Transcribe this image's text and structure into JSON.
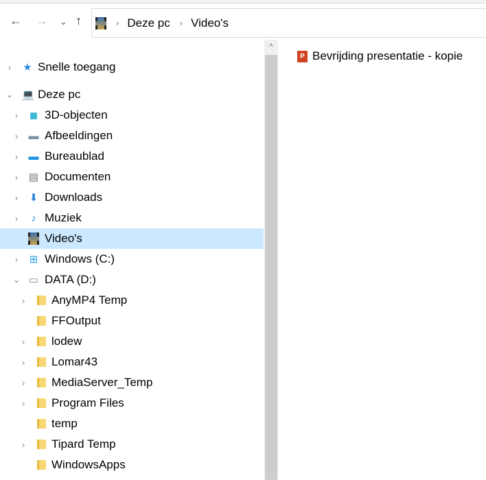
{
  "toolbar": {
    "back": "←",
    "forward": "→",
    "recent": "⌄",
    "up": "↑"
  },
  "address": {
    "crumbs": [
      "Deze pc",
      "Video's"
    ]
  },
  "tree": {
    "quick_access": "Snelle toegang",
    "this_pc": "Deze pc",
    "pc_items": [
      "3D-objecten",
      "Afbeeldingen",
      "Bureaublad",
      "Documenten",
      "Downloads",
      "Muziek",
      "Video's",
      "Windows (C:)",
      "DATA (D:)"
    ],
    "data_items": [
      "AnyMP4 Temp",
      "FFOutput",
      "lodew",
      "Lomar43",
      "MediaServer_Temp",
      "Program Files",
      "temp",
      "Tipard Temp",
      "WindowsApps"
    ]
  },
  "files": [
    {
      "name": "Bevrijding presentatie - kopie"
    }
  ],
  "colors": {
    "selection": "#cce8ff"
  }
}
